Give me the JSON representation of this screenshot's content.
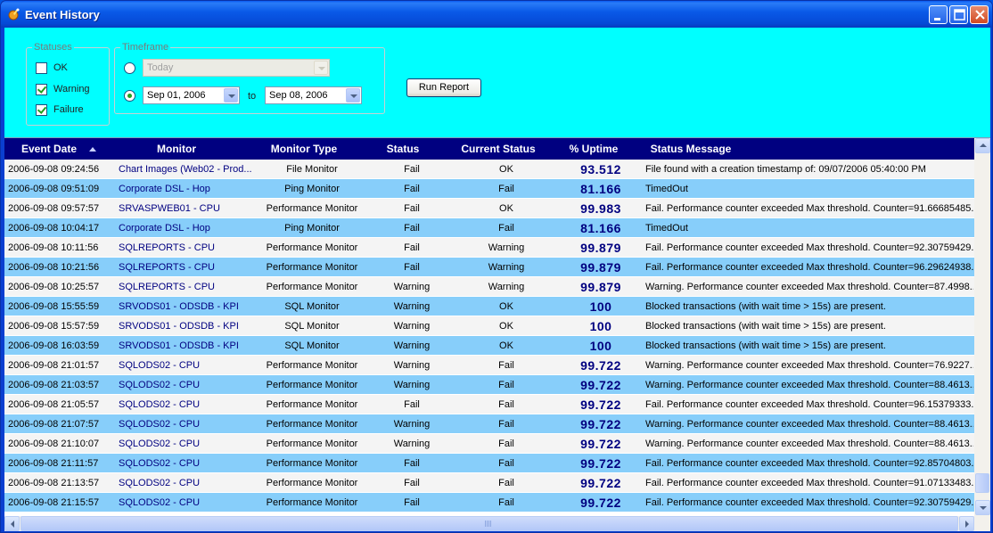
{
  "window": {
    "title": "Event History"
  },
  "statuses": {
    "legend": "Statuses",
    "items": [
      {
        "label": "OK",
        "checked": false
      },
      {
        "label": "Warning",
        "checked": true
      },
      {
        "label": "Failure",
        "checked": true
      }
    ]
  },
  "timeframe": {
    "legend": "Timeframe",
    "preset_value": "Today",
    "from_value": "Sep 01, 2006",
    "to_label": "to",
    "to_value": "Sep 08, 2006"
  },
  "run_report_label": "Run Report",
  "grid": {
    "columns": [
      "Event Date",
      "Monitor",
      "Monitor Type",
      "Status",
      "Current Status",
      "% Uptime",
      "Status Message"
    ],
    "rows": [
      [
        "2006-09-08 09:24:56",
        "Chart Images (Web02 - Prod...",
        "File Monitor",
        "Fail",
        "OK",
        "93.512",
        "File found with a creation timestamp of: 09/07/2006 05:40:00 PM"
      ],
      [
        "2006-09-08 09:51:09",
        "Corporate DSL - Hop",
        "Ping Monitor",
        "Fail",
        "Fail",
        "81.166",
        "TimedOut"
      ],
      [
        "2006-09-08 09:57:57",
        "SRVASPWEB01 - CPU",
        "Performance Monitor",
        "Fail",
        "OK",
        "99.983",
        "Fail. Performance counter exceeded Max threshold. Counter=91.66685485..."
      ],
      [
        "2006-09-08 10:04:17",
        "Corporate DSL - Hop",
        "Ping Monitor",
        "Fail",
        "Fail",
        "81.166",
        "TimedOut"
      ],
      [
        "2006-09-08 10:11:56",
        "SQLREPORTS - CPU",
        "Performance Monitor",
        "Fail",
        "Warning",
        "99.879",
        "Fail. Performance counter exceeded Max threshold. Counter=92.30759429..."
      ],
      [
        "2006-09-08 10:21:56",
        "SQLREPORTS - CPU",
        "Performance Monitor",
        "Fail",
        "Warning",
        "99.879",
        "Fail. Performance counter exceeded Max threshold. Counter=96.29624938..."
      ],
      [
        "2006-09-08 10:25:57",
        "SQLREPORTS - CPU",
        "Performance Monitor",
        "Warning",
        "Warning",
        "99.879",
        "Warning. Performance counter exceeded Max threshold. Counter=87.4998..."
      ],
      [
        "2006-09-08 15:55:59",
        "SRVODS01 - ODSDB - KPI",
        "SQL Monitor",
        "Warning",
        "OK",
        "100",
        "Blocked transactions (with wait time > 15s) are present."
      ],
      [
        "2006-09-08 15:57:59",
        "SRVODS01 - ODSDB - KPI",
        "SQL Monitor",
        "Warning",
        "OK",
        "100",
        "Blocked transactions (with wait time > 15s) are present."
      ],
      [
        "2006-09-08 16:03:59",
        "SRVODS01 - ODSDB - KPI",
        "SQL Monitor",
        "Warning",
        "OK",
        "100",
        "Blocked transactions (with wait time > 15s) are present."
      ],
      [
        "2006-09-08 21:01:57",
        "SQLODS02 - CPU",
        "Performance Monitor",
        "Warning",
        "Fail",
        "99.722",
        "Warning. Performance counter exceeded Max threshold. Counter=76.9227..."
      ],
      [
        "2006-09-08 21:03:57",
        "SQLODS02 - CPU",
        "Performance Monitor",
        "Warning",
        "Fail",
        "99.722",
        "Warning. Performance counter exceeded Max threshold. Counter=88.4613..."
      ],
      [
        "2006-09-08 21:05:57",
        "SQLODS02 - CPU",
        "Performance Monitor",
        "Fail",
        "Fail",
        "99.722",
        "Fail. Performance counter exceeded Max threshold. Counter=96.15379333..."
      ],
      [
        "2006-09-08 21:07:57",
        "SQLODS02 - CPU",
        "Performance Monitor",
        "Warning",
        "Fail",
        "99.722",
        "Warning. Performance counter exceeded Max threshold. Counter=88.4613..."
      ],
      [
        "2006-09-08 21:10:07",
        "SQLODS02 - CPU",
        "Performance Monitor",
        "Warning",
        "Fail",
        "99.722",
        "Warning. Performance counter exceeded Max threshold. Counter=88.4613..."
      ],
      [
        "2006-09-08 21:11:57",
        "SQLODS02 - CPU",
        "Performance Monitor",
        "Fail",
        "Fail",
        "99.722",
        "Fail. Performance counter exceeded Max threshold. Counter=92.85704803..."
      ],
      [
        "2006-09-08 21:13:57",
        "SQLODS02 - CPU",
        "Performance Monitor",
        "Fail",
        "Fail",
        "99.722",
        "Fail. Performance counter exceeded Max threshold. Counter=91.07133483..."
      ],
      [
        "2006-09-08 21:15:57",
        "SQLODS02 - CPU",
        "Performance Monitor",
        "Fail",
        "Fail",
        "99.722",
        "Fail. Performance counter exceeded Max threshold. Counter=92.30759429..."
      ]
    ]
  },
  "colors": {
    "client_background": "#00FFFF",
    "header_background": "#000080",
    "row_alt": "#87CEFA",
    "row_base": "#F4F4F4",
    "monitor_text": "#000080"
  },
  "icons": {
    "app": "app-icon",
    "minimize": "minimize-icon",
    "maximize": "maximize-icon",
    "close": "close-icon",
    "sort": "sort-ascending-icon"
  }
}
